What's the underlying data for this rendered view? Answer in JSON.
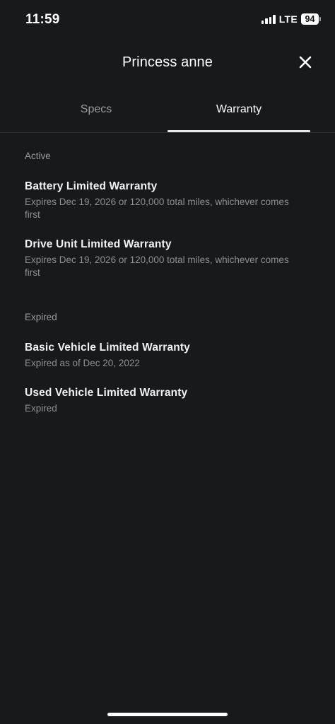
{
  "status_bar": {
    "time": "11:59",
    "network": "LTE",
    "battery": "94"
  },
  "header": {
    "title": "Princess anne"
  },
  "tabs": [
    {
      "label": "Specs",
      "active": false
    },
    {
      "label": "Warranty",
      "active": true
    }
  ],
  "sections": {
    "active": {
      "label": "Active",
      "items": [
        {
          "title": "Battery Limited Warranty",
          "subtitle": "Expires Dec 19, 2026 or 120,000 total miles, whichever comes first"
        },
        {
          "title": "Drive Unit Limited Warranty",
          "subtitle": "Expires Dec 19, 2026 or 120,000 total miles, whichever comes first"
        }
      ]
    },
    "expired": {
      "label": "Expired",
      "items": [
        {
          "title": "Basic Vehicle Limited Warranty",
          "subtitle": "Expired as of Dec 20, 2022"
        },
        {
          "title": "Used Vehicle Limited Warranty",
          "subtitle": "Expired"
        }
      ]
    }
  },
  "colors": {
    "background": "#18191b",
    "text_primary": "#ffffff",
    "text_secondary": "#8e8f91",
    "tab_inactive": "#9a9b9d",
    "tab_indicator": "#e8e8e8"
  }
}
